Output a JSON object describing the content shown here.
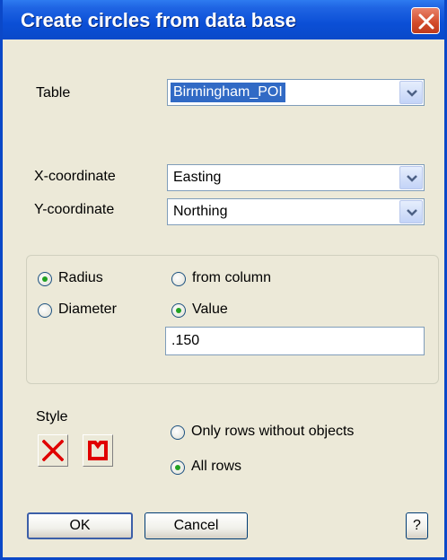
{
  "window": {
    "title": "Create circles from data base"
  },
  "table": {
    "label": "Table",
    "value": "Birmingham_POI"
  },
  "x_coordinate": {
    "label": "X-coordinate",
    "value": "Easting"
  },
  "y_coordinate": {
    "label": "Y-coordinate",
    "value": "Northing"
  },
  "size_mode": {
    "radius_label": "Radius",
    "diameter_label": "Diameter",
    "selected": "Radius"
  },
  "size_source": {
    "from_column_label": "from column",
    "value_label": "Value",
    "selected": "Value",
    "value": ".150"
  },
  "style": {
    "label": "Style",
    "symbol_icon": "red-cross-icon",
    "region_icon": "red-region-icon",
    "color": "#e00000"
  },
  "rows": {
    "only_without_objects_label": "Only rows without objects",
    "all_rows_label": "All rows",
    "selected": "All rows"
  },
  "buttons": {
    "ok": "OK",
    "cancel": "Cancel",
    "help": "?"
  },
  "colors": {
    "titlebar": "#0b4fd6",
    "dialog_bg": "#ece9d8",
    "selection": "#316ac5"
  }
}
